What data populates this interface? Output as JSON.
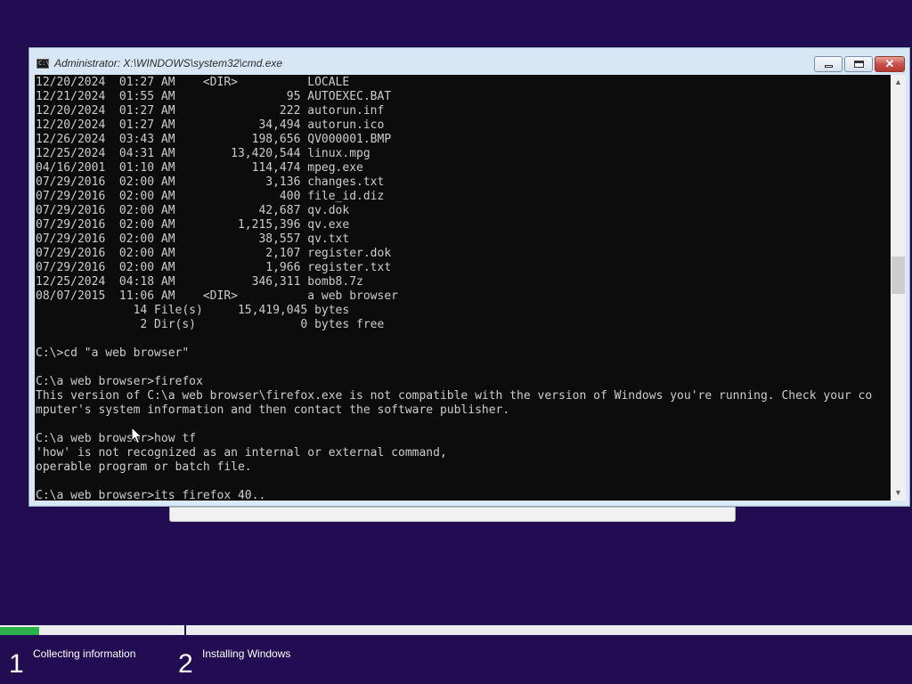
{
  "window": {
    "title": "Administrator: X:\\WINDOWS\\system32\\cmd.exe",
    "icon_text": "C:\\",
    "buttons": [
      "minimize",
      "maximize",
      "close"
    ],
    "close_glyph": "✕"
  },
  "console": {
    "lines": [
      "12/20/2024  01:27 AM    <DIR>          LOCALE",
      "12/21/2024  01:55 AM                95 AUTOEXEC.BAT",
      "12/20/2024  01:27 AM               222 autorun.inf",
      "12/20/2024  01:27 AM            34,494 autorun.ico",
      "12/26/2024  03:43 AM           198,656 QV000001.BMP",
      "12/25/2024  04:31 AM        13,420,544 linux.mpg",
      "04/16/2001  01:10 AM           114,474 mpeg.exe",
      "07/29/2016  02:00 AM             3,136 changes.txt",
      "07/29/2016  02:00 AM               400 file_id.diz",
      "07/29/2016  02:00 AM            42,687 qv.dok",
      "07/29/2016  02:00 AM         1,215,396 qv.exe",
      "07/29/2016  02:00 AM            38,557 qv.txt",
      "07/29/2016  02:00 AM             2,107 register.dok",
      "07/29/2016  02:00 AM             1,966 register.txt",
      "12/25/2024  04:18 AM           346,311 bomb8.7z",
      "08/07/2015  11:06 AM    <DIR>          a web browser",
      "              14 File(s)     15,419,045 bytes",
      "               2 Dir(s)               0 bytes free",
      "",
      "C:\\>cd \"a web browser\"",
      "",
      "C:\\a web browser>firefox",
      "This version of C:\\a web browser\\firefox.exe is not compatible with the version of Windows you're running. Check your co",
      "mputer's system information and then contact the software publisher.",
      "",
      "C:\\a web browser>how tf",
      "'how' is not recognized as an internal or external command,",
      "operable program or batch file.",
      "",
      "C:\\a web browser>its firefox 40.."
    ]
  },
  "scrollbar": {
    "up_glyph": "▲",
    "down_glyph": "▼"
  },
  "setup": {
    "progress_fraction": 0.043,
    "steps": [
      {
        "number": "1",
        "label": "Collecting information"
      },
      {
        "number": "2",
        "label": "Installing Windows"
      }
    ],
    "colors": {
      "background": "#220c52",
      "progress": "#2bb24c"
    }
  }
}
